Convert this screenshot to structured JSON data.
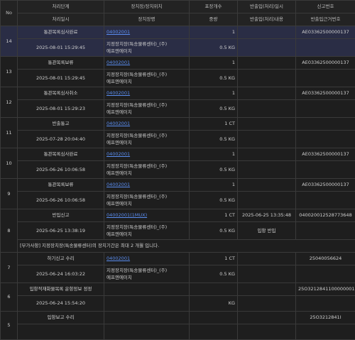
{
  "headers": {
    "no": "No",
    "row1": [
      "처리단계",
      "장치장/장치위치",
      "포장개수",
      "반출입(처리)일시",
      "신고번호"
    ],
    "row2": [
      "처리일시",
      "장치장명",
      "중량",
      "반출입(처리)내용",
      "반출입근거번호"
    ]
  },
  "entries": [
    {
      "no": "14",
      "step": "통관목록심사완료",
      "time": "2025-08-01 15:29:45",
      "code": "04002001",
      "name_line1": "지정장치장(특송물류센터)_(주)",
      "name_line2": "에프엔에이치",
      "count": "1",
      "weight": "0.5 KG",
      "io_time": "",
      "io_content": "",
      "report_no": "AE03362500000137",
      "ref_no": "",
      "selected": true
    },
    {
      "no": "13",
      "step": "통관목록보류",
      "time": "2025-08-01 15:29:45",
      "code": "04002001",
      "name_line1": "지정장치장(특송물류센터)_(주)",
      "name_line2": "에프엔에이치",
      "count": "1",
      "weight": "0.5 KG",
      "io_time": "",
      "io_content": "",
      "report_no": "AE03362500000137",
      "ref_no": ""
    },
    {
      "no": "12",
      "step": "통관목록심사취소",
      "time": "2025-08-01 15:29:23",
      "code": "04002001",
      "name_line1": "지정장치장(특송물류센터)_(주)",
      "name_line2": "에프엔에이치",
      "count": "1",
      "weight": "0.5 KG",
      "io_time": "",
      "io_content": "",
      "report_no": "AE03362500000137",
      "ref_no": ""
    },
    {
      "no": "11",
      "step": "반출통고",
      "time": "2025-07-28 20:04:40",
      "code": "04002001",
      "name_line1": "지정장치장(특송물류센터)_(주)",
      "name_line2": "에프엔에이치",
      "count": "1 CT",
      "weight": "0.5 KG",
      "io_time": "",
      "io_content": "",
      "report_no": "",
      "ref_no": ""
    },
    {
      "no": "10",
      "step": "통관목록심사완료",
      "time": "2025-06-26 10:06:58",
      "code": "04002001",
      "name_line1": "지정장치장(특송물류센터)_(주)",
      "name_line2": "에프엔에이치",
      "count": "1",
      "weight": "0.5 KG",
      "io_time": "",
      "io_content": "",
      "report_no": "AE03362500000137",
      "ref_no": ""
    },
    {
      "no": "9",
      "step": "통관목록보류",
      "time": "2025-06-26 10:06:58",
      "code": "04002001",
      "name_line1": "지정장치장(특송물류센터)_(주)",
      "name_line2": "에프엔에이치",
      "count": "1",
      "weight": "0.5 KG",
      "io_time": "",
      "io_content": "",
      "report_no": "AE03362500000137",
      "ref_no": ""
    },
    {
      "no": "8",
      "step": "반입신고",
      "time": "2025-06-25 13:38:19",
      "code": "04002001(1MUX)",
      "name_line1": "지정장치장(특송물류센터)_(주)",
      "name_line2": "에프엔에이치",
      "count": "1 CT",
      "weight": "0.5 KG",
      "io_time": "2025-06-25 13:35:48",
      "io_content": "입항 반입",
      "report_no": "040020012528773648",
      "ref_no": "",
      "note": "[부가사항] 지정장치장(특송물류센터)의 장치기간은 최대 2 개월 입니다."
    },
    {
      "no": "7",
      "step": "하기신고 수리",
      "time": "2025-06-24 16:03:22",
      "code": "04002001",
      "name_line1": "지정장치장(특송물류센터)_(주)",
      "name_line2": "에프엔에이치",
      "count": "1 CT",
      "weight": "0.5 KG",
      "io_time": "",
      "io_content": "",
      "report_no": "25040056624",
      "ref_no": ""
    },
    {
      "no": "6",
      "step": "입항적재화물목록 운항정보 정정",
      "time": "2025-06-24 15:54:20",
      "code": "",
      "name_line1": "",
      "name_line2": "",
      "count": "",
      "weight": "KG",
      "io_time": "",
      "io_content": "",
      "report_no": "25O3212841100000001",
      "ref_no": ""
    },
    {
      "no": "5",
      "step": "입항보고 수리",
      "time": "",
      "code": "",
      "name_line1": "",
      "name_line2": "",
      "count": "",
      "weight": "",
      "io_time": "",
      "io_content": "",
      "report_no": "25O3212841I",
      "ref_no": ""
    }
  ]
}
